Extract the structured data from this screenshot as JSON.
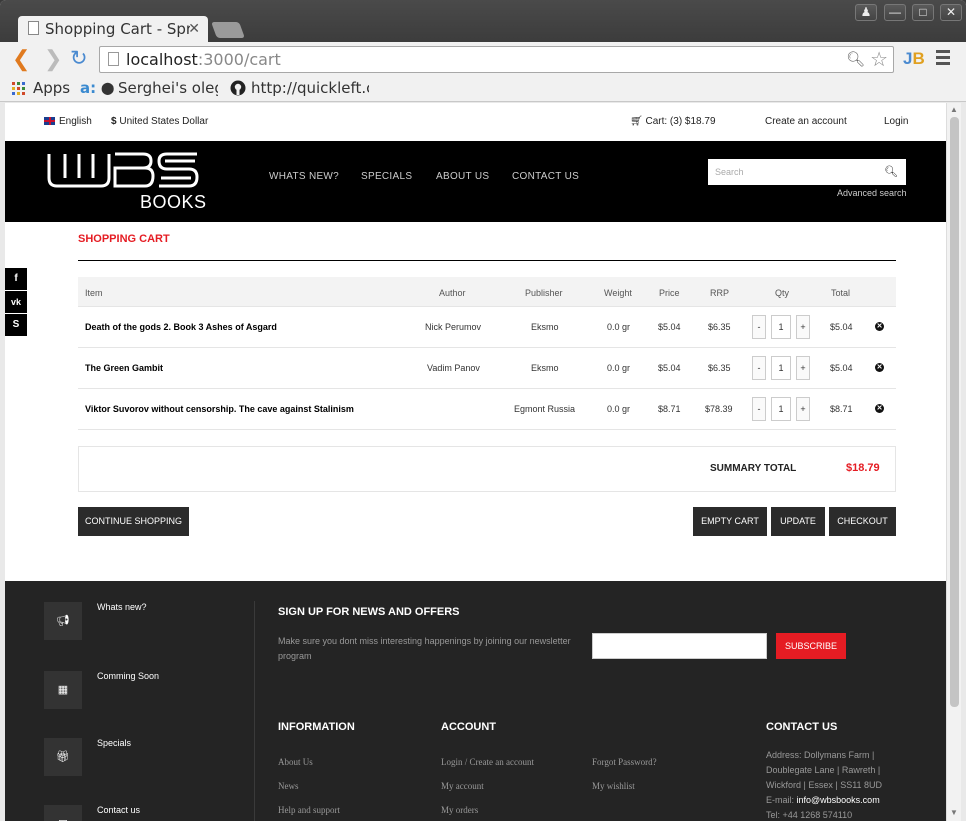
{
  "browser": {
    "tab_title": "Shopping Cart - Spre",
    "url_host": "localhost",
    "url_rest": ":3000/cart",
    "bookmarks": [
      "Apps",
      "Serghei's olegl",
      "http://quickleft.c"
    ],
    "jb": "J",
    "jb2": "B"
  },
  "topbar": {
    "language": "English",
    "currency": "United States Dollar",
    "cart": "Cart: (3) $18.79",
    "create_account": "Create an account",
    "login": "Login"
  },
  "header": {
    "logo_text": "BOOKS",
    "nav": [
      "WHATS NEW?",
      "SPECIALS",
      "ABOUT US",
      "CONTACT US"
    ],
    "search_placeholder": "Search",
    "advanced_search": "Advanced search"
  },
  "social": [
    "f",
    "vk",
    "S"
  ],
  "cart": {
    "title": "SHOPPING CART",
    "columns": [
      "Item",
      "Author",
      "Publisher",
      "Weight",
      "Price",
      "RRP",
      "Qty",
      "Total"
    ],
    "rows": [
      {
        "item": "Death of the gods 2. Book 3 Ashes of Asgard",
        "author": "Nick Perumov",
        "publisher": "Eksmo",
        "weight": "0.0 gr",
        "price": "$5.04",
        "rrp": "$6.35",
        "qty": "1",
        "total": "$5.04"
      },
      {
        "item": "The Green Gambit",
        "author": "Vadim Panov",
        "publisher": "Eksmo",
        "weight": "0.0 gr",
        "price": "$5.04",
        "rrp": "$6.35",
        "qty": "1",
        "total": "$5.04"
      },
      {
        "item": "Viktor Suvorov without censorship. The cave against Stalinism",
        "author": "",
        "publisher": "Egmont Russia",
        "weight": "0.0 gr",
        "price": "$8.71",
        "rrp": "$78.39",
        "qty": "1",
        "total": "$8.71"
      }
    ],
    "summary_label": "SUMMARY TOTAL",
    "summary_value": "$18.79",
    "continue": "CONTINUE SHOPPING",
    "empty": "EMPTY CART",
    "update": "UPDATE",
    "checkout": "CHECKOUT"
  },
  "footer": {
    "side_items": [
      "Whats new?",
      "Comming Soon",
      "Specials",
      "Contact us"
    ],
    "newsletter_title": "SIGN UP FOR NEWS AND OFFERS",
    "newsletter_text": "Make sure you dont miss interesting happenings by joining our newsletter program",
    "subscribe": "SUBSCRIBE",
    "info_title": "INFORMATION",
    "info_links": [
      "About Us",
      "News",
      "Help and support"
    ],
    "account_title": "ACCOUNT",
    "account_links": [
      "Login / Create an account",
      "My account",
      "My orders"
    ],
    "account_links2": [
      "Forgot Password?",
      "My wishlist"
    ],
    "contact_title": "CONTACT US",
    "address1": "Address: Dollymans Farm |",
    "address2": "Doublegate Lane | Rawreth |",
    "address3": "Wickford | Essex | SS11 8UD",
    "email_label": "E-mail: ",
    "email": "info@wbsbooks.com",
    "tel": "Tel: +44 1268 574110"
  }
}
